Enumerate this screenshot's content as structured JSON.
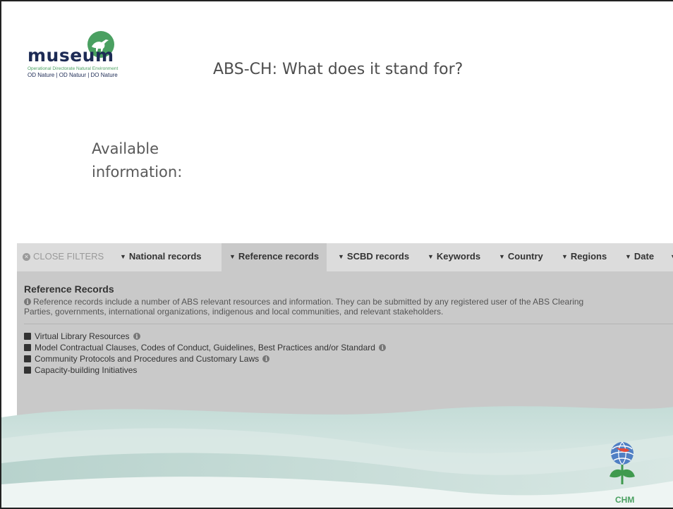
{
  "logo": {
    "word": "museum",
    "line1": "Operational Directorate Natural Environment",
    "line2": "OD Nature | OD Natuur | DO Nature"
  },
  "slide": {
    "title": "ABS-CH: What does it stand for?",
    "subtitle_line1": "Available",
    "subtitle_line2": "information:"
  },
  "filters": {
    "close_label": "CLOSE FILTERS",
    "tabs": [
      {
        "label": "National records"
      },
      {
        "label": "Reference records"
      },
      {
        "label": "SCBD records"
      },
      {
        "label": "Keywords"
      },
      {
        "label": "Country"
      },
      {
        "label": "Regions"
      },
      {
        "label": "Date"
      }
    ],
    "active_tab": "Reference records"
  },
  "reference": {
    "title": "Reference Records",
    "desc_line1": "Reference records include a number of ABS relevant resources and information. They can be submitted by any registered user of the ABS Clearing",
    "desc_line2": "Parties, governments, international organizations, indigenous and local communities, and relevant stakeholders.",
    "categories": [
      {
        "label": "Virtual Library Resources",
        "info": true
      },
      {
        "label": "Model Contractual Clauses, Codes of Conduct, Guidelines, Best Practices and/or Standard",
        "info": true
      },
      {
        "label": "Community Protocols and Procedures and Customary Laws",
        "info": true
      },
      {
        "label": "Capacity-building Initiatives",
        "info": false
      }
    ]
  },
  "chm": {
    "label": "CHM"
  },
  "colors": {
    "logo_navy": "#1d2b55",
    "logo_green": "#4aa061",
    "wave_teal": "#b9d4cf"
  }
}
